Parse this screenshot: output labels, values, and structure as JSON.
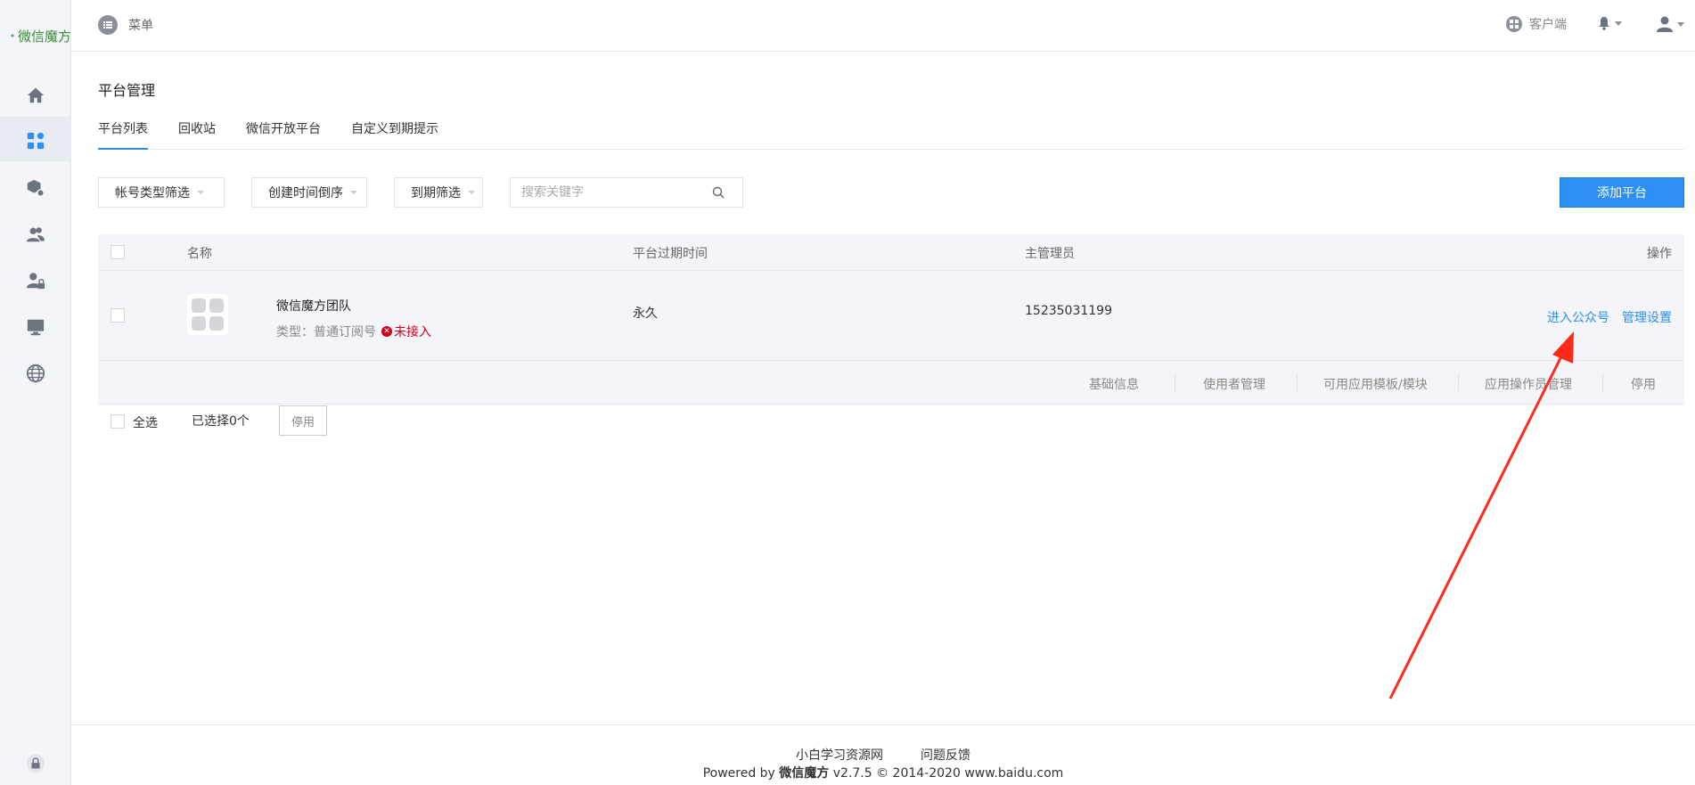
{
  "sidebar": {
    "logo_text": "微信魔方",
    "items": [
      {
        "icon": "home-icon"
      },
      {
        "icon": "apps-icon",
        "active": true
      },
      {
        "icon": "module-icon"
      },
      {
        "icon": "users-icon"
      },
      {
        "icon": "user-lock-icon"
      },
      {
        "icon": "monitor-icon"
      },
      {
        "icon": "globe-icon"
      }
    ],
    "bottom_icon": "lock-icon"
  },
  "header": {
    "menu_label": "菜单",
    "client_label": "客户端"
  },
  "page": {
    "title": "平台管理",
    "tabs": [
      {
        "label": "平台列表",
        "active": true
      },
      {
        "label": "回收站"
      },
      {
        "label": "微信开放平台"
      },
      {
        "label": "自定义到期提示"
      }
    ]
  },
  "filters": {
    "account_type": "帐号类型筛选",
    "sort_created": "创建时间倒序",
    "expire_filter": "到期筛选",
    "search_placeholder": "搜索关键字",
    "add_button": "添加平台"
  },
  "table": {
    "headers": {
      "name": "名称",
      "expire": "平台过期时间",
      "admin": "主管理员",
      "actions": "操作"
    },
    "rows": [
      {
        "name": "微信魔方团队",
        "type_label": "类型：普通订阅号",
        "status": "未接入",
        "expire": "永久",
        "admin": "15235031199",
        "action_enter": "进入公众号",
        "action_manage": "管理设置",
        "sub_links": [
          "基础信息",
          "使用者管理",
          "可用应用模板/模块",
          "应用操作员管理",
          "停用"
        ]
      }
    ]
  },
  "bulk": {
    "select_all": "全选",
    "selected_count": "已选择0个",
    "disable_button": "停用"
  },
  "footer": {
    "link1": "小白学习资源网",
    "link2": "问题反馈",
    "powered_prefix": "Powered by ",
    "brand": "微信魔方",
    "powered_suffix": " v2.7.5 © 2014-2020 www.baidu.com"
  },
  "colors": {
    "accent": "#2b8ff3",
    "danger": "#d0021b",
    "annotation_arrow": "#ff2a1a"
  }
}
